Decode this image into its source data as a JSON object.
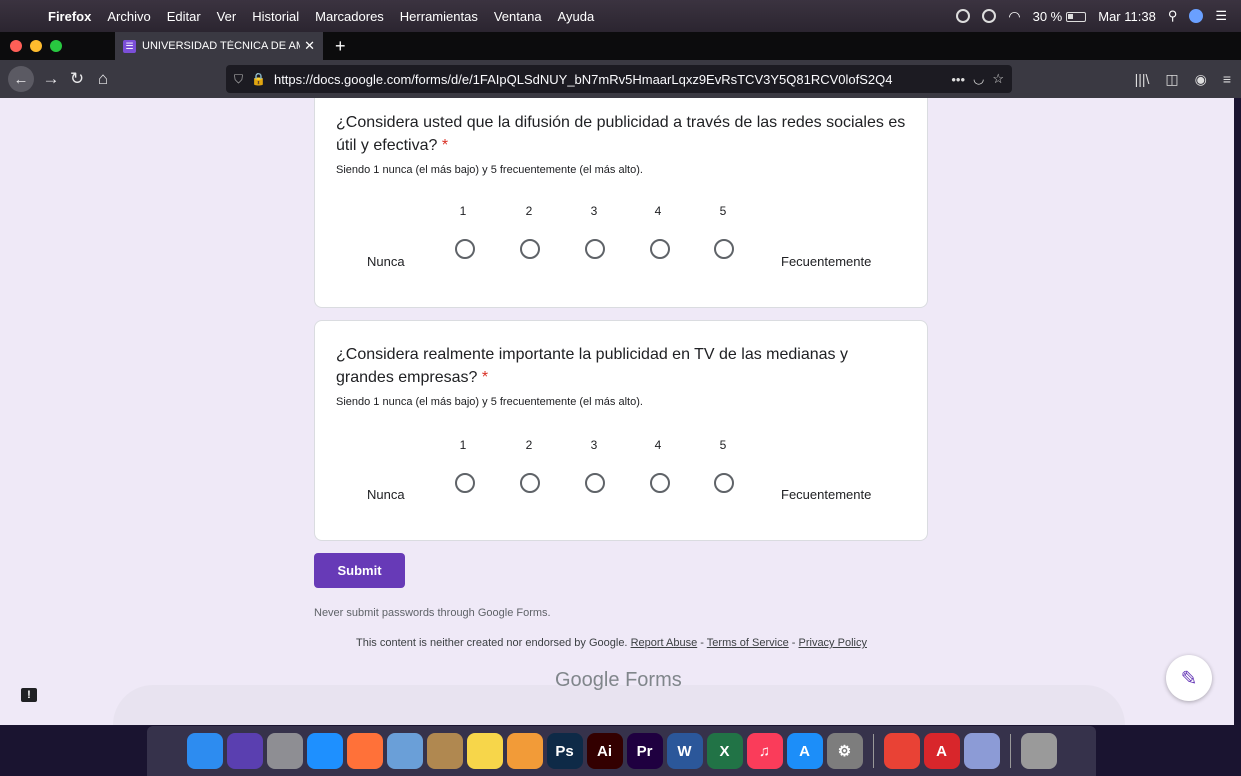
{
  "menubar": {
    "apple": "",
    "app_name": "Firefox",
    "items": [
      "Archivo",
      "Editar",
      "Ver",
      "Historial",
      "Marcadores",
      "Herramientas",
      "Ventana",
      "Ayuda"
    ],
    "battery": "30 %",
    "clock": "Mar 11:38"
  },
  "browser": {
    "tab_title": "UNIVERSIDAD TÉCNICA DE AM",
    "tab_icon": "☰",
    "tab_close": "✕",
    "new_tab": "+",
    "url": "https://docs.google.com/forms/d/e/1FAIpQLSdNUY_bN7mRv5HmaarLqxz9EvRsTCV3Y5Q81RCV0lofS2Q4",
    "more": "•••"
  },
  "questions": [
    {
      "title": "¿Considera usted que la difusión de publicidad a través de las redes sociales es útil y efectiva?",
      "required_mark": "*",
      "description": "Siendo 1 nunca (el más bajo) y 5 frecuentemente (el más alto).",
      "scale": [
        "1",
        "2",
        "3",
        "4",
        "5"
      ],
      "low_label": "Nunca",
      "high_label": "Fecuentemente"
    },
    {
      "title": "¿Considera realmente importante la publicidad en TV de las medianas y grandes empresas?",
      "required_mark": "*",
      "description": "Siendo 1 nunca (el más bajo) y 5 frecuentemente (el más alto).",
      "scale": [
        "1",
        "2",
        "3",
        "4",
        "5"
      ],
      "low_label": "Nunca",
      "high_label": "Fecuentemente"
    }
  ],
  "form": {
    "submit_label": "Submit",
    "password_warning": "Never submit passwords through Google Forms.",
    "disclaimer": "This content is neither created nor endorsed by Google.",
    "report_abuse": "Report Abuse",
    "terms": "Terms of Service",
    "privacy": "Privacy Policy",
    "brand_google": "Google",
    "brand_forms": "Forms"
  },
  "dock": {
    "apps": [
      {
        "name": "finder-icon",
        "label": "",
        "color": "#2d8cf0"
      },
      {
        "name": "siri-icon",
        "label": "",
        "color": "#5a3fb0"
      },
      {
        "name": "launchpad-icon",
        "label": "",
        "color": "#8e8e93"
      },
      {
        "name": "safari-icon",
        "label": "",
        "color": "#1e90ff"
      },
      {
        "name": "firefox-icon",
        "label": "",
        "color": "#ff7139"
      },
      {
        "name": "preview-icon",
        "label": "",
        "color": "#6a9fd8"
      },
      {
        "name": "contacts-icon",
        "label": "",
        "color": "#b08850"
      },
      {
        "name": "notes-icon",
        "label": "",
        "color": "#f7d64a"
      },
      {
        "name": "photos-icon",
        "label": "",
        "color": "#f29b38"
      },
      {
        "name": "photoshop-icon",
        "label": "Ps",
        "color": "#0e2a47"
      },
      {
        "name": "illustrator-icon",
        "label": "Ai",
        "color": "#330000"
      },
      {
        "name": "premiere-icon",
        "label": "Pr",
        "color": "#1f0040"
      },
      {
        "name": "word-icon",
        "label": "W",
        "color": "#2b579a"
      },
      {
        "name": "excel-icon",
        "label": "X",
        "color": "#217346"
      },
      {
        "name": "music-icon",
        "label": "♫",
        "color": "#fa3c5a"
      },
      {
        "name": "appstore-icon",
        "label": "A",
        "color": "#1c8ef9"
      },
      {
        "name": "system-preferences-icon",
        "label": "⚙",
        "color": "#7d7d7d"
      },
      {
        "name": "chrome-icon",
        "label": "",
        "color": "#e94235"
      },
      {
        "name": "acrobat-icon",
        "label": "A",
        "color": "#d8262b"
      },
      {
        "name": "torrent-icon",
        "label": "",
        "color": "#8c9bd6"
      },
      {
        "name": "trash-icon",
        "label": "",
        "color": "#9a9a9a"
      }
    ]
  }
}
